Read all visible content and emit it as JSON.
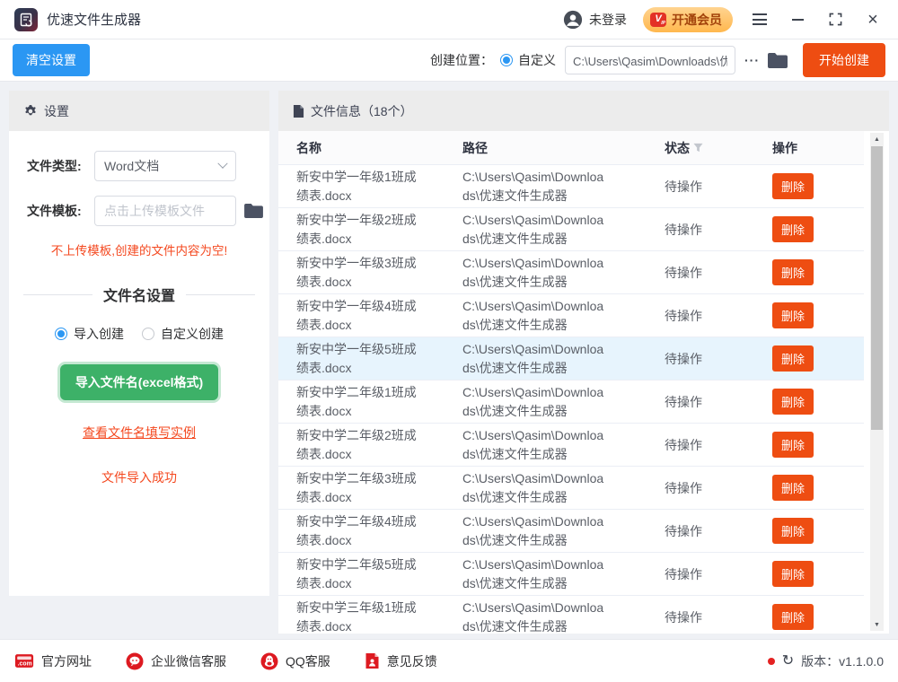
{
  "titlebar": {
    "app_title": "优速文件生成器",
    "login_status": "未登录",
    "vip_badge_v": "V",
    "vip_badge_ip": "IP",
    "vip_button": "开通会员"
  },
  "toolbar": {
    "clear_button": "清空设置",
    "location_label": "创建位置：",
    "location_option": "自定义",
    "path_value": "C:\\Users\\Qasim\\Downloads\\优",
    "ellipsis_label": "···",
    "create_button": "开始创建"
  },
  "sidebar": {
    "header": "设置",
    "file_type_label": "文件类型:",
    "file_type_value": "Word文档",
    "template_label": "文件模板:",
    "template_placeholder": "点击上传模板文件",
    "warning": "不上传模板,创建的文件内容为空!",
    "filename_section_title": "文件名设置",
    "radio_import": "导入创建",
    "radio_custom": "自定义创建",
    "import_button": "导入文件名(excel格式)",
    "example_link": "查看文件名填写实例",
    "import_status": "文件导入成功"
  },
  "table": {
    "panel_title": "文件信息（18个）",
    "columns": [
      "名称",
      "路径",
      "状态",
      "操作"
    ],
    "delete_label": "删除",
    "highlighted_row_index": 4,
    "rows": [
      {
        "name": "新安中学一年级1班成绩表.docx",
        "path": "C:\\Users\\Qasim\\Downloads\\优速文件生成器",
        "status": "待操作"
      },
      {
        "name": "新安中学一年级2班成绩表.docx",
        "path": "C:\\Users\\Qasim\\Downloads\\优速文件生成器",
        "status": "待操作"
      },
      {
        "name": "新安中学一年级3班成绩表.docx",
        "path": "C:\\Users\\Qasim\\Downloads\\优速文件生成器",
        "status": "待操作"
      },
      {
        "name": "新安中学一年级4班成绩表.docx",
        "path": "C:\\Users\\Qasim\\Downloads\\优速文件生成器",
        "status": "待操作"
      },
      {
        "name": "新安中学一年级5班成绩表.docx",
        "path": "C:\\Users\\Qasim\\Downloads\\优速文件生成器",
        "status": "待操作"
      },
      {
        "name": "新安中学二年级1班成绩表.docx",
        "path": "C:\\Users\\Qasim\\Downloads\\优速文件生成器",
        "status": "待操作"
      },
      {
        "name": "新安中学二年级2班成绩表.docx",
        "path": "C:\\Users\\Qasim\\Downloads\\优速文件生成器",
        "status": "待操作"
      },
      {
        "name": "新安中学二年级3班成绩表.docx",
        "path": "C:\\Users\\Qasim\\Downloads\\优速文件生成器",
        "status": "待操作"
      },
      {
        "name": "新安中学二年级4班成绩表.docx",
        "path": "C:\\Users\\Qasim\\Downloads\\优速文件生成器",
        "status": "待操作"
      },
      {
        "name": "新安中学二年级5班成绩表.docx",
        "path": "C:\\Users\\Qasim\\Downloads\\优速文件生成器",
        "status": "待操作"
      },
      {
        "name": "新安中学三年级1班成绩表.docx",
        "path": "C:\\Users\\Qasim\\Downloads\\优速文件生成器",
        "status": "待操作"
      }
    ]
  },
  "footer": {
    "links": [
      "官方网址",
      "企业微信客服",
      "QQ客服",
      "意见反馈"
    ],
    "version_label": "版本：v1.1.0.0"
  },
  "icons": {
    "app": "document-refresh",
    "user": "person-circle",
    "vip": "vip-badge",
    "menu": "hamburger",
    "minimize": "minus-bar",
    "maximize": "corner-brackets",
    "close": "×",
    "gear": "settings-gear",
    "folder": "folder",
    "file": "document",
    "filter": "funnel",
    "website": "dot-com-box",
    "wechat": "chat-bubble",
    "qq": "penguin-circle",
    "feedback": "document-person",
    "refresh": "↻"
  },
  "colors": {
    "accent_blue": "#2b97f3",
    "accent_orange": "#ee4d12",
    "accent_green": "#3db168",
    "warning_red": "#f4481f",
    "vip_gradient": "#ffd490-#ffb84e",
    "row_highlight": "#e7f4fd",
    "panel_header_bg": "#ececec",
    "page_bg": "#eff1f5",
    "footer_icon_red": "#dd1a21"
  }
}
